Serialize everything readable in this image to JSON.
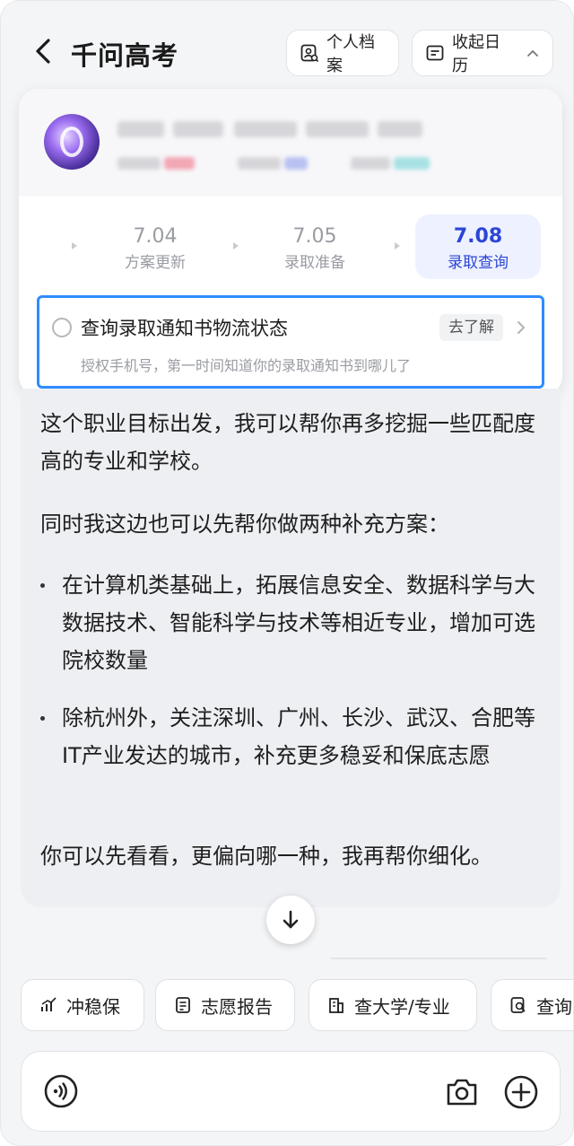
{
  "header": {
    "title": "千问高考",
    "profile_label": "个人档案",
    "calendar_label": "收起日历"
  },
  "timeline": [
    {
      "date": "7.04",
      "label": "方案更新",
      "active": false
    },
    {
      "date": "7.05",
      "label": "录取准备",
      "active": false
    },
    {
      "date": "7.08",
      "label": "录取查询",
      "active": true
    }
  ],
  "query_card": {
    "title": "查询录取通知书物流状态",
    "action": "去了解",
    "subtitle": "授权手机号，第一时间知道你的录取通知书到哪儿了"
  },
  "message": {
    "para1": "这个职业目标出发，我可以帮你再多挖掘一些匹配度高的专业和学校。",
    "para2": "同时我这边也可以先帮你做两种补充方案：",
    "bullets": [
      "在计算机类基础上，拓展信息安全、数据科学与大数据技术、智能科学与技术等相近专业，增加可选院校数量",
      "除杭州外，关注深圳、广州、长沙、武汉、合肥等IT产业发达的城市，补充更多稳妥和保底志愿"
    ],
    "para3": "你可以先看看，更偏向哪一种，我再帮你细化。"
  },
  "tools": [
    {
      "label": "冲稳保",
      "icon": "chart-icon"
    },
    {
      "label": "志愿报告",
      "icon": "report-icon"
    },
    {
      "label": "查大学/专业",
      "icon": "building-icon"
    },
    {
      "label": "查询",
      "icon": "search-doc-icon"
    }
  ],
  "colors": {
    "accent_blue": "#2a46d6",
    "highlight_border": "#2f8cff",
    "background": "#f4f5f7"
  }
}
